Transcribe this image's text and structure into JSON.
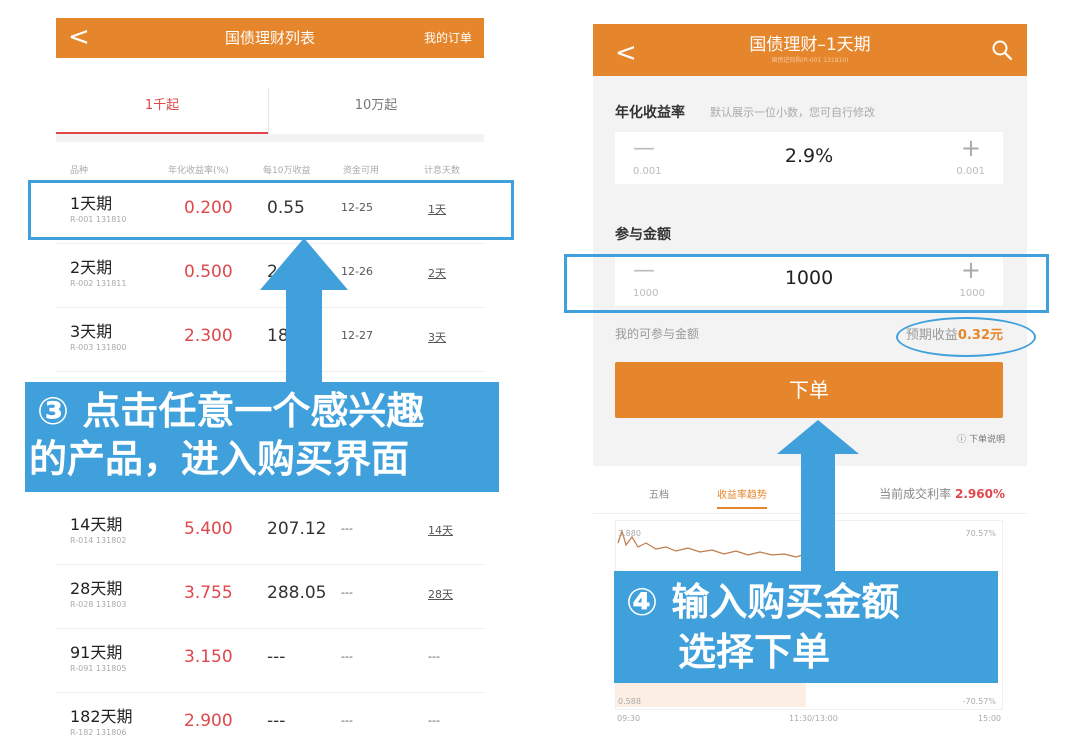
{
  "left": {
    "header": {
      "back": "<",
      "title": "国债理财列表",
      "my_orders": "我的订单"
    },
    "tabs": [
      "1千起",
      "10万起"
    ],
    "columns": [
      "品种",
      "年化收益率(%)",
      "每10万收益",
      "资金可用",
      "计息天数"
    ],
    "rows": [
      {
        "name": "1天期",
        "code": "R-001 131810",
        "rate": "0.200",
        "earn": "0.55",
        "fund": "12-25",
        "days": "1天"
      },
      {
        "name": "2天期",
        "code": "R-002 131811",
        "rate": "0.500",
        "earn": "2.7",
        "fund": "12-26",
        "days": "2天"
      },
      {
        "name": "3天期",
        "code": "R-003 131800",
        "rate": "2.300",
        "earn": "18.9",
        "fund": "12-27",
        "days": "3天"
      },
      {
        "name": "14天期",
        "code": "R-014 131802",
        "rate": "5.400",
        "earn": "207.12",
        "fund": "---",
        "days": "14天"
      },
      {
        "name": "28天期",
        "code": "R-028 131803",
        "rate": "3.755",
        "earn": "288.05",
        "fund": "---",
        "days": "28天"
      },
      {
        "name": "91天期",
        "code": "R-091 131805",
        "rate": "3.150",
        "earn": "---",
        "fund": "---",
        "days": "---"
      },
      {
        "name": "182天期",
        "code": "R-182 131806",
        "rate": "2.900",
        "earn": "---",
        "fund": "---",
        "days": "---"
      }
    ]
  },
  "right": {
    "header": {
      "back": "<",
      "title": "国债理财–1天期",
      "subtitle": "国债逆回购(R-001 131810)"
    },
    "rate_section": {
      "label": "年化收益率",
      "hint": "默认展示一位小数，您可自行修改",
      "minus": "—",
      "plus": "+",
      "step": "0.001",
      "value": "2.9%"
    },
    "amount_section": {
      "label": "参与金额",
      "minus": "—",
      "plus": "+",
      "step": "1000",
      "value": "1000"
    },
    "my_amount": "我的可参与金额",
    "expected": {
      "label": "预期收益",
      "value": "0.32元"
    },
    "order_button": "下单",
    "order_note": "ⓘ 下单说明",
    "tabs": [
      "五档",
      "收益率趋势"
    ],
    "current_rate": {
      "label": "当前成交利率",
      "value": "2.960%"
    },
    "chart": {
      "y_top_left": "3.880",
      "y_top_right": "70.57%",
      "y_bottom_left": "0.588",
      "y_bottom_right": "-70.57%",
      "x_labels": [
        "09:30",
        "11:30/13:00",
        "15:00"
      ]
    }
  },
  "callouts": {
    "step3_line1": "③ 点击任意一个感兴趣",
    "step3_line2": "的产品，进入购买界面",
    "step4_line1": "④ 输入购买金额",
    "step4_line2": "选择下单"
  },
  "colors": {
    "brand_orange": "#e6862c",
    "rate_red": "#e0474b",
    "annotation_blue": "#3fa0dc"
  }
}
